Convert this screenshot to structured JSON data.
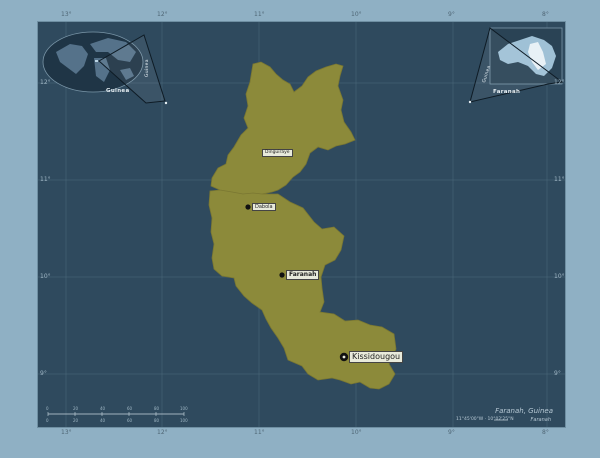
{
  "title": "Faranah, Guinea",
  "coords": "11°45'00\"W  ·  10°02'25\"N",
  "legend_label": "Faranah",
  "scale_top_ticks": [
    "0",
    "20",
    "40",
    "60",
    "80",
    "100"
  ],
  "scale_bottom_ticks": [
    "0",
    "20",
    "40",
    "60",
    "80",
    "100"
  ],
  "lon_labels": [
    "13°",
    "12°",
    "11°",
    "10°",
    "9°",
    "8°"
  ],
  "lat_labels": [
    "12°",
    "11°",
    "10°",
    "9°"
  ],
  "cities": [
    {
      "name": "Dabola",
      "style": "small"
    },
    {
      "name": "Dinguiraye",
      "style": "small"
    },
    {
      "name": "Faranah",
      "style": "bold"
    },
    {
      "name": "Kissidougou",
      "style": "big"
    }
  ],
  "inset_left": {
    "label": "Guinea",
    "side_label": "Guinea"
  },
  "inset_right": {
    "label": "Faranah",
    "side_label": "Guinea"
  },
  "colors": {
    "region_fill": "#8c8a3a",
    "sea": "#2f4a5e",
    "frame": "#8fb0c4"
  }
}
